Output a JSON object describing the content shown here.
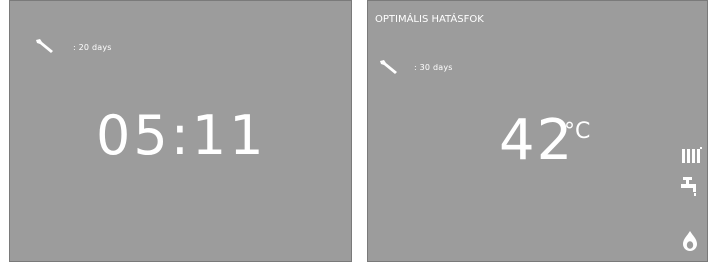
{
  "left_display": {
    "service": {
      "icon": "wrench-icon",
      "text": ": 20 days"
    },
    "clock": "05:11"
  },
  "right_display": {
    "mode_title": "OPTIMÁLIS HATÁSFOK",
    "service": {
      "icon": "wrench-icon",
      "text": ": 30 days"
    },
    "temperature": {
      "value": "42",
      "unit": "°C"
    },
    "status_icons": [
      "radiator-icon",
      "faucet-icon",
      "flame-icon"
    ]
  },
  "colors": {
    "screen_bg": "#9c9c9c",
    "foreground": "#ffffff",
    "border": "#7a7a7a"
  }
}
